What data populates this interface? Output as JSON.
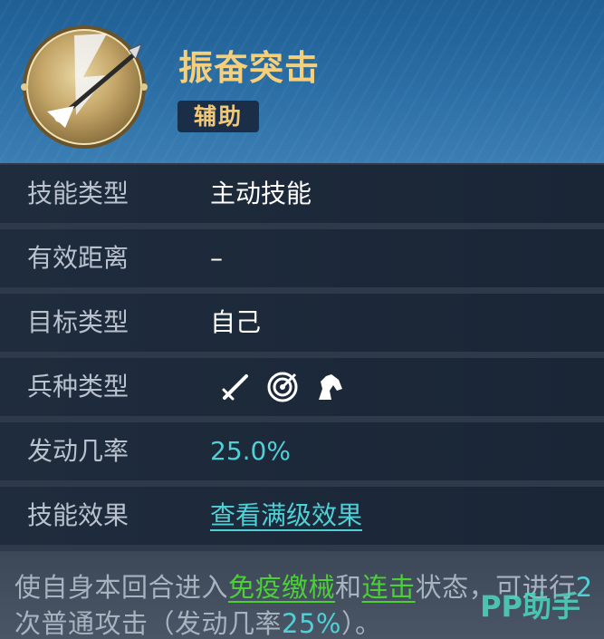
{
  "skill": {
    "name": "振奋突击",
    "tag": "辅助",
    "icon": "spear-lightning-icon"
  },
  "rows": {
    "type": {
      "label": "技能类型",
      "value": "主动技能"
    },
    "range": {
      "label": "有效距离",
      "value": "–"
    },
    "target": {
      "label": "目标类型",
      "value": "自己"
    },
    "troops": {
      "label": "兵种类型",
      "icons": [
        "sword-icon",
        "target-icon",
        "horse-icon"
      ]
    },
    "rate": {
      "label": "发动几率",
      "value": "25.0%"
    },
    "effect": {
      "label": "技能效果",
      "link": "查看满级效果"
    }
  },
  "description": {
    "p1": "使自身本回合进入",
    "k1": "免疫缴械",
    "p2": "和",
    "k2": "连击",
    "p3": "状态，可进行",
    "n1": "2",
    "p4": "次普通攻击（发动几率",
    "n2": "25%",
    "p5": "）。"
  },
  "watermark": "PP助手",
  "colors": {
    "title": "#f5cf7a",
    "keyword_green": "#4ccf37",
    "accent_teal": "#4fd0d6"
  }
}
